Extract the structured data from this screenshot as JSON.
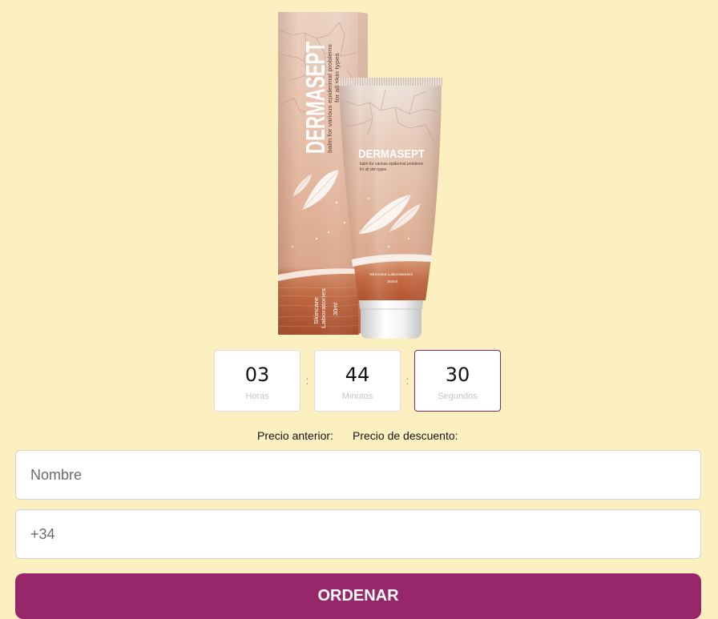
{
  "colors": {
    "page_background": "#fcefc0",
    "order_button": "#97266b",
    "countdown_border": "#dedede",
    "countdown_active_border": "#8e2563"
  },
  "product": {
    "box": {
      "brand": "DERMASEPT",
      "tagline_line1": "balm for various epidermal problems",
      "tagline_line2": "for all skin types",
      "maker_line1": "Skincare",
      "maker_line2": "Laboratories",
      "volume": "30ml"
    },
    "tube": {
      "brand": "DERMASEPT",
      "tagline_line1": "balm for various epidermal problems",
      "tagline_line2": "for all skin types",
      "maker": "Skincare Laboratories",
      "volume": "30ml"
    }
  },
  "countdown": {
    "separator": ":",
    "units": [
      {
        "value": "03",
        "label": "Horas"
      },
      {
        "value": "44",
        "label": "Minutos"
      },
      {
        "value": "30",
        "label": "Segundos"
      }
    ]
  },
  "prices": {
    "old_price_label": "Precio anterior:",
    "discount_price_label": "Precio de descuento:"
  },
  "order_form": {
    "name_placeholder": "Nombre",
    "phone_placeholder": "+34",
    "submit_label": "ORDENAR"
  }
}
